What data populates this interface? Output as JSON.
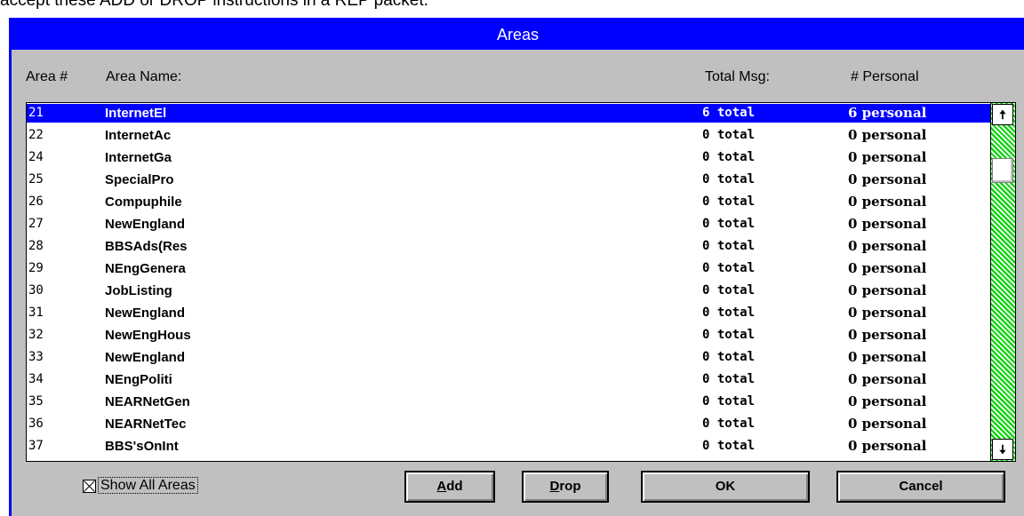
{
  "caption_text": "accept these ADD or DROP instructions in a REP packet.",
  "window": {
    "title": "Areas"
  },
  "headers": {
    "area_num": "Area #",
    "area_name": "Area Name:",
    "total_msg": "Total Msg:",
    "personal": "# Personal"
  },
  "rows": [
    {
      "num": "21",
      "name": "InternetEl",
      "total": "6 total",
      "personal": "6 personal",
      "selected": true
    },
    {
      "num": "22",
      "name": "InternetAc",
      "total": "0 total",
      "personal": "0 personal"
    },
    {
      "num": "24",
      "name": "InternetGa",
      "total": "0 total",
      "personal": "0 personal"
    },
    {
      "num": "25",
      "name": "SpecialPro",
      "total": "0 total",
      "personal": "0 personal"
    },
    {
      "num": "26",
      "name": "Compuphile",
      "total": "0 total",
      "personal": "0 personal"
    },
    {
      "num": "27",
      "name": "NewEngland",
      "total": "0 total",
      "personal": "0 personal"
    },
    {
      "num": "28",
      "name": "BBSAds(Res",
      "total": "0 total",
      "personal": "0 personal"
    },
    {
      "num": "29",
      "name": "NEngGenera",
      "total": "0 total",
      "personal": "0 personal"
    },
    {
      "num": "30",
      "name": "JobListing",
      "total": "0 total",
      "personal": "0 personal"
    },
    {
      "num": "31",
      "name": "NewEngland",
      "total": "0 total",
      "personal": "0 personal"
    },
    {
      "num": "32",
      "name": "NewEngHous",
      "total": "0 total",
      "personal": "0 personal"
    },
    {
      "num": "33",
      "name": "NewEngland",
      "total": "0 total",
      "personal": "0 personal"
    },
    {
      "num": "34",
      "name": "NEngPoliti",
      "total": "0 total",
      "personal": "0 personal"
    },
    {
      "num": "35",
      "name": "NEARNetGen",
      "total": "0 total",
      "personal": "0 personal"
    },
    {
      "num": "36",
      "name": "NEARNetTec",
      "total": "0 total",
      "personal": "0 personal"
    },
    {
      "num": "37",
      "name": "BBS'sOnInt",
      "total": "0 total",
      "personal": "0 personal"
    }
  ],
  "scrollbar": {
    "up_icon": "arrow-up-icon",
    "down_icon": "arrow-down-icon",
    "up_glyph": "🠅",
    "down_glyph": "🠇"
  },
  "show_all": {
    "label": "Show All Areas",
    "checked": true
  },
  "buttons": {
    "add": "Add",
    "drop": "Drop",
    "ok": "OK",
    "cancel": "Cancel"
  },
  "colors": {
    "title_bar": "#0000ff",
    "dialog": "#c0c0c0",
    "selection": "#0000ff",
    "scroll_track": "#00d000"
  }
}
